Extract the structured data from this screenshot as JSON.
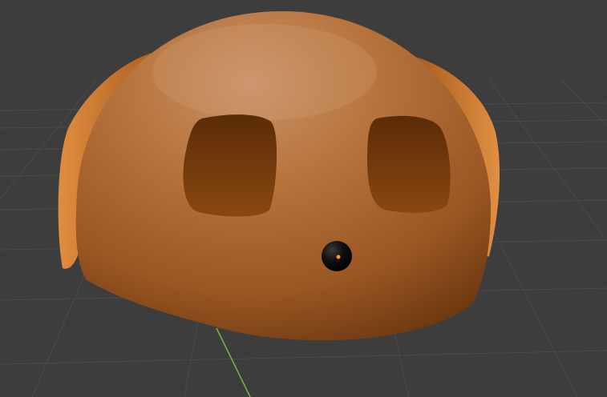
{
  "viewport": {
    "background_color": "#3d3d3d",
    "grid_color": "#4a4a4a",
    "y_axis_color": "#7db33a",
    "view": "perspective"
  },
  "object": {
    "shape": "dome-head",
    "base_color": "#b86a2e",
    "highlight_color": "#c98a5a",
    "shadow_color": "#7a3f10",
    "ear_color": "#d9823a",
    "eye_recess_color": "#6a3608",
    "nose_color": "#0a0a0a",
    "origin_color": "#ff9a1a"
  }
}
